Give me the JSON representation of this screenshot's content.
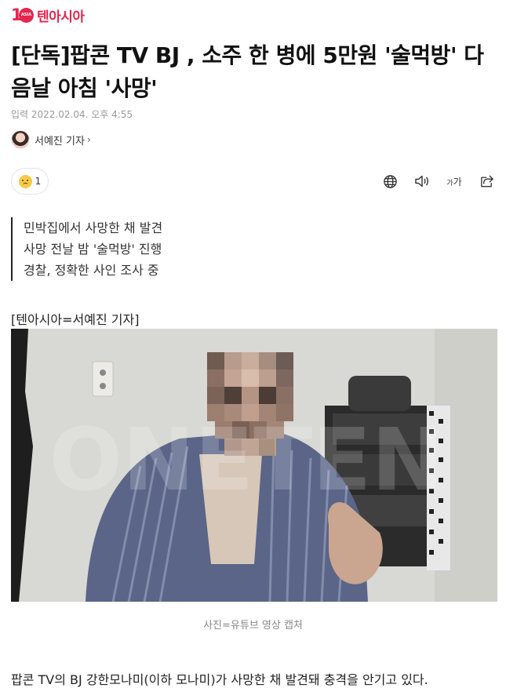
{
  "header": {
    "logo_number": "1",
    "logo_badge": "ASIA",
    "logo_text": "텐아시아"
  },
  "article": {
    "title": "[단독]팝콘 TV BJ , 소주 한 병에 5만원 '술먹방' 다음날 아침 '사망'",
    "date": "입력 2022.02.04. 오후 4:55",
    "reporter": "서예진 기자",
    "reaction_count": "1",
    "summary": [
      "민박집에서 사망한 채 발견",
      "사망 전날 밤 '술먹방' 진행",
      "경찰, 정확한 사인 조사 중"
    ],
    "credit": "[텐아시아=서예진 기자]",
    "photo_caption": "사진=유튜브 영상 캡처",
    "body_first_line": "팝콘 TV의 BJ 강한모나미(이하 모나미)가 사망한 채 발견돼 충격을 안기고 있다."
  },
  "toolbar": {
    "font_size_small": "가",
    "font_size_large": "가"
  },
  "icons": {
    "reaction": "sad-face-icon",
    "translate": "globe-icon",
    "listen": "speaker-icon",
    "font_size": "font-size-icon",
    "share": "share-icon",
    "reporter_link": "chevron-right-icon"
  },
  "colors": {
    "brand": "#e6254e",
    "text": "#111111",
    "muted": "#999999"
  }
}
